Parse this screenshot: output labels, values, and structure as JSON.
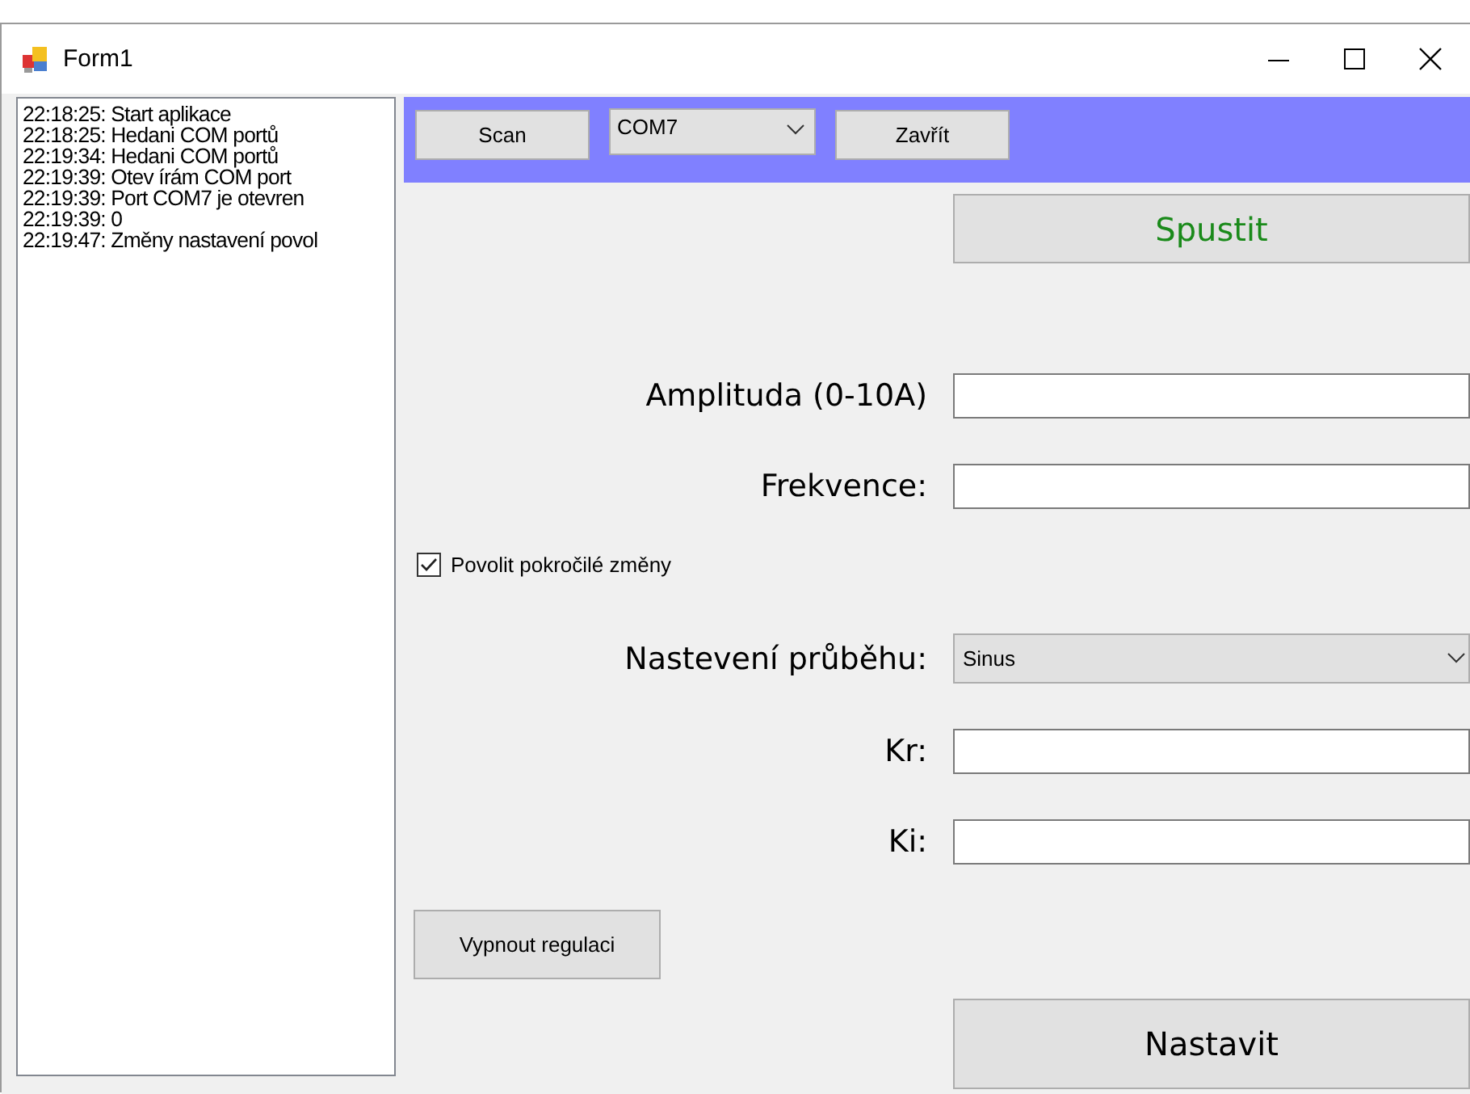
{
  "window": {
    "title": "Form1"
  },
  "log": {
    "lines": [
      "22:18:25: Start aplikace",
      "22:18:25: Hedani COM portů",
      "22:19:34: Hedani COM portů",
      "22:19:39: Otev írám COM port",
      "22:19:39: Port COM7 je otevren",
      "22:19:39: 0",
      "22:19:47: Změny nastavení povol"
    ]
  },
  "toolbar": {
    "scan_button": "Scan",
    "port_select": {
      "value": "COM7"
    },
    "close_button": "Zavřít"
  },
  "start_button": {
    "label": "Spustit"
  },
  "rows": [
    {
      "kind": "text",
      "label": "Amplituda (0-10A)"
    },
    {
      "kind": "text",
      "label": "Frekvence:"
    },
    {
      "kind": "checkbox",
      "label": "Povolit pokročilé změny",
      "checked": true
    },
    {
      "kind": "select",
      "label": "Nastevení průběhu:",
      "value": "Sinus"
    },
    {
      "kind": "text",
      "label": "Kr:"
    },
    {
      "kind": "text",
      "label": "Ki:"
    }
  ],
  "regulation_button": {
    "label": "Vypnout regulaci"
  },
  "apply_button": {
    "label": "Nastavit"
  }
}
